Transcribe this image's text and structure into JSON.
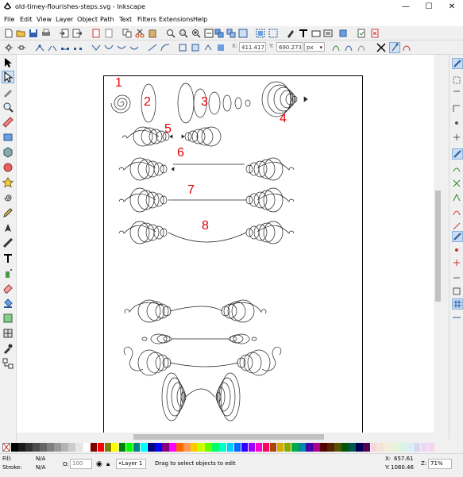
{
  "window": {
    "title": "old-timey-flourishes-steps.svg - Inkscape",
    "minimize": "—",
    "maximize": "☐",
    "close": "✕"
  },
  "menu": [
    "File",
    "Edit",
    "View",
    "Layer",
    "Object",
    "Path",
    "Text",
    "Filters",
    "Extensions",
    "Help"
  ],
  "toolbar_controls": {
    "x_label": "X:",
    "x_value": "411.417",
    "y_label": "Y:",
    "y_value": "690.273",
    "units": "px"
  },
  "canvas_labels": [
    "1",
    "2",
    "3",
    "4",
    "5",
    "6",
    "7",
    "8"
  ],
  "palette_colors": [
    "#000000",
    "#1a1a1a",
    "#333333",
    "#4d4d4d",
    "#666666",
    "#808080",
    "#999999",
    "#b3b3b3",
    "#cccccc",
    "#e6e6e6",
    "#ffffff",
    "#800000",
    "#ff0000",
    "#808000",
    "#ffff00",
    "#008000",
    "#00ff00",
    "#008080",
    "#00ffff",
    "#000080",
    "#0000ff",
    "#800080",
    "#ff00ff",
    "#ff6600",
    "#ff9955",
    "#ffcc00",
    "#ccff00",
    "#66ff00",
    "#00ff66",
    "#00ffcc",
    "#00ccff",
    "#0066ff",
    "#3300ff",
    "#9900ff",
    "#ff00cc",
    "#ff0066",
    "#aa4400",
    "#d4aa00",
    "#88aa00",
    "#00aa44",
    "#0088aa",
    "#4400aa",
    "#aa0088",
    "#550000",
    "#552200",
    "#555500",
    "#005500",
    "#005555",
    "#000055",
    "#550055",
    "#f4d7d7",
    "#f4e3d7",
    "#f4eed7",
    "#e3f4d7",
    "#d7f4e3",
    "#d7eef4",
    "#d7d7f4",
    "#eed7f4",
    "#f4d7ee"
  ],
  "status": {
    "fill_label": "Fill:",
    "fill_value": "N/A",
    "stroke_label": "Stroke:",
    "stroke_value": "N/A",
    "opacity_label": "O:",
    "opacity_value": "100",
    "layer": "•Layer 1",
    "message": "Drag to select objects to edit",
    "cursor_x_label": "X:",
    "cursor_x": "657.61",
    "cursor_y_label": "Y:",
    "cursor_y": "1080.46",
    "zoom_label": "Z:",
    "zoom": "71%"
  }
}
